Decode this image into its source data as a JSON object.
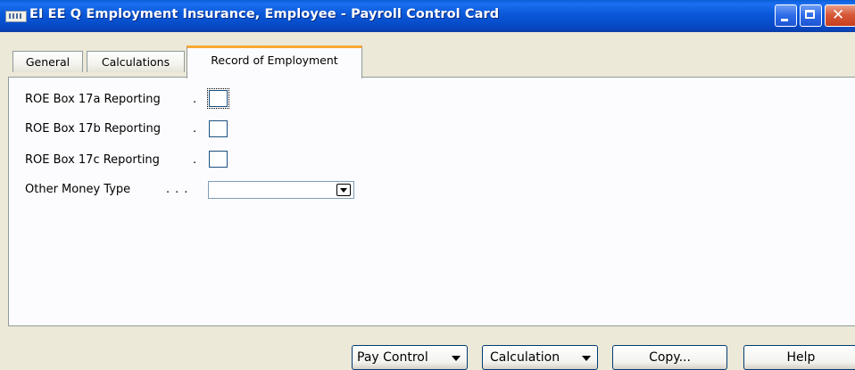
{
  "window": {
    "title": "EI EE Q Employment Insurance, Employee - Payroll Control Card"
  },
  "tabs": [
    {
      "label": "General",
      "active": false
    },
    {
      "label": "Calculations",
      "active": false
    },
    {
      "label": "Record of Employment",
      "active": true
    }
  ],
  "fields": {
    "roe_17a": {
      "label": "ROE Box 17a Reporting",
      "checked": false
    },
    "roe_17b": {
      "label": "ROE Box 17b Reporting",
      "checked": false
    },
    "roe_17c": {
      "label": "ROE Box 17c Reporting",
      "checked": false
    },
    "other_money": {
      "label": "Other Money Type",
      "value": ""
    }
  },
  "buttons": {
    "pay_control": "Pay Control",
    "calculation": "Calculation",
    "copy": "Copy...",
    "help": "Help"
  },
  "colors": {
    "titlebar": "#0a58d8",
    "active_tab_accent": "#f7a932",
    "window_background": "#ece9d8"
  }
}
